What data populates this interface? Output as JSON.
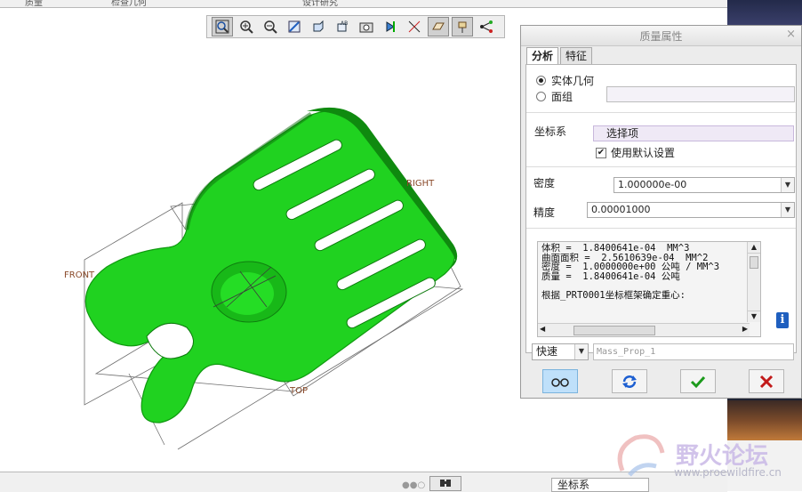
{
  "top_strip": {
    "items": [
      "质量",
      "检查几何",
      "设计研究"
    ]
  },
  "toolbar": {
    "buttons": [
      {
        "icon": "zoom-fit-icon"
      },
      {
        "icon": "zoom-in-icon"
      },
      {
        "icon": "zoom-out-icon"
      },
      {
        "icon": "repaint-icon"
      },
      {
        "icon": "display-style-icon"
      },
      {
        "icon": "saved-views-icon"
      },
      {
        "icon": "view-manager-icon"
      },
      {
        "icon": "datum-display-icon"
      },
      {
        "icon": "axis-display-icon"
      },
      {
        "icon": "plane-display-icon"
      },
      {
        "icon": "point-display-icon"
      },
      {
        "icon": "csys-display-icon"
      }
    ]
  },
  "viewport": {
    "datum_labels": {
      "right": "RIGHT",
      "front": "FRONT",
      "top": "TOP"
    },
    "colors": {
      "part": "#1fd21f",
      "datum": "#8a4a2a"
    }
  },
  "dialog": {
    "title": "质量属性",
    "close": "×",
    "tabs": [
      "分析",
      "特征"
    ],
    "geometry": {
      "solid_label": "实体几何",
      "quilt_label": "面组",
      "solid_selected": true
    },
    "csys": {
      "label": "坐标系",
      "placeholder": "选择项",
      "use_default_label": "使用默认设置",
      "use_default_checked": true
    },
    "density": {
      "label": "密度",
      "value": "1.000000e-00"
    },
    "accuracy": {
      "label": "精度",
      "value": "0.00001000"
    },
    "results": [
      "体积 =  1.8400641e-04  MM^3",
      "曲面面积 =  2.5610639e-04  MM^2",
      "密度 =  1.0000000e+00 公吨 / MM^3",
      "质量 =  1.8400641e-04 公吨",
      "",
      "根据_PRT0001坐标框架确定重心:"
    ],
    "mode": {
      "value": "快速"
    },
    "name": {
      "value": "Mass_Prop_1"
    },
    "footer_buttons": [
      "preview-icon",
      "repeat-icon",
      "ok-icon",
      "cancel-icon"
    ],
    "info_icon": "info-icon"
  },
  "statusbar": {
    "filter_value": "坐标系"
  },
  "watermark": {
    "text": "野火论坛",
    "url": "www.proewildfire.cn"
  }
}
